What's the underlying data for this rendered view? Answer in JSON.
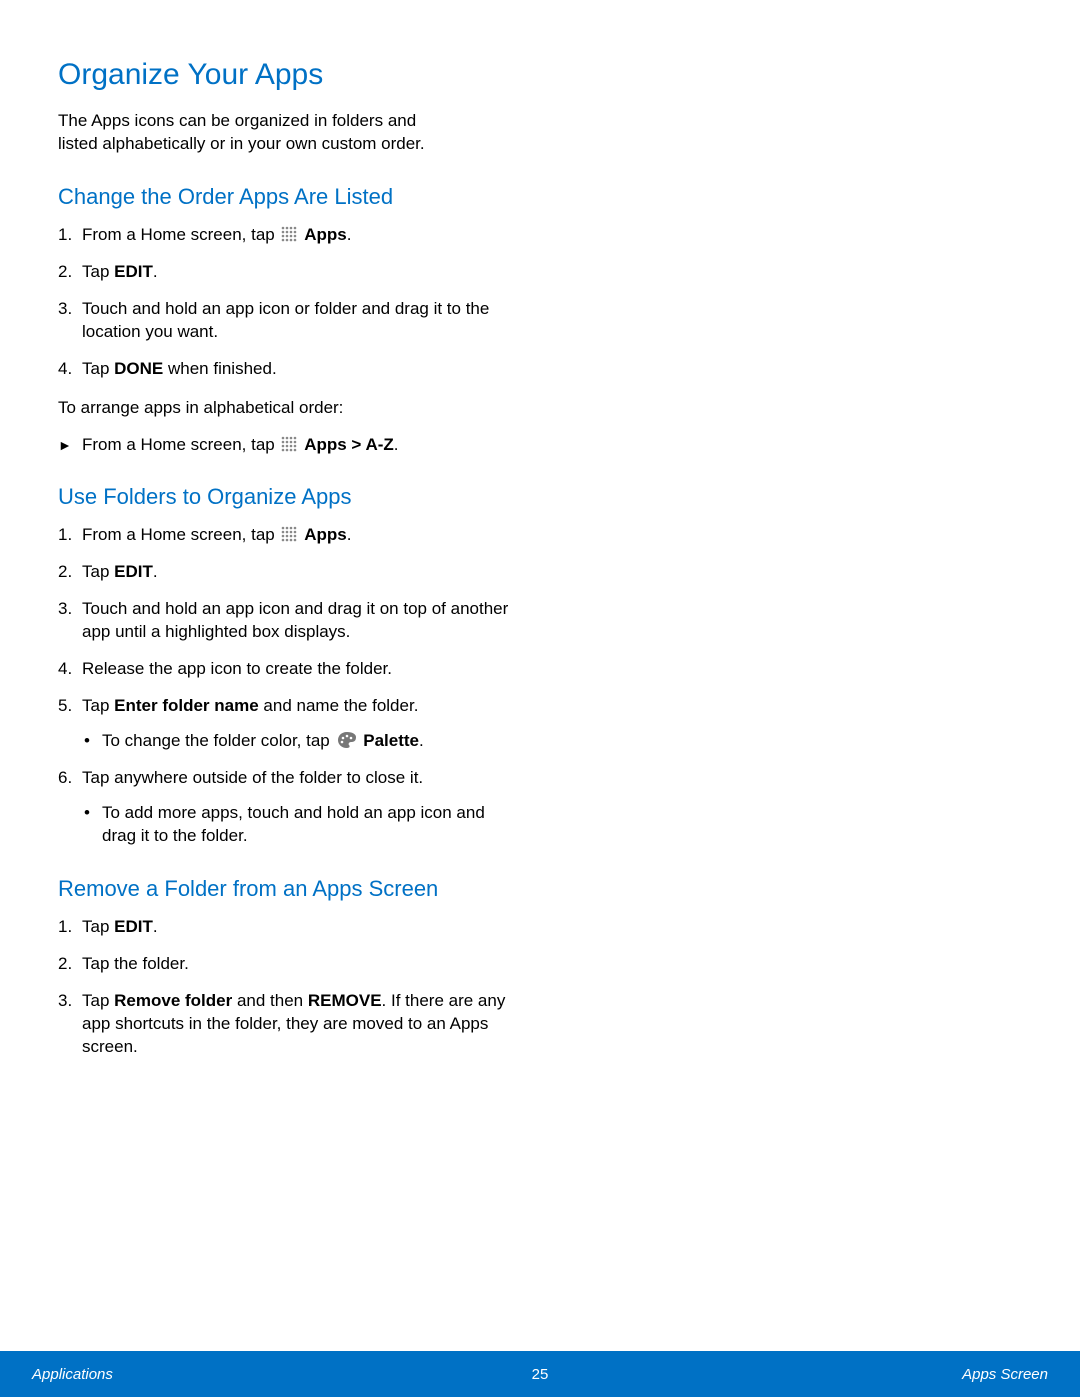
{
  "title": "Organize Your Apps",
  "intro_line1": "The Apps icons can be organized in folders and",
  "intro_line2": "listed alphabetically or in your own custom order.",
  "sections": {
    "s1": {
      "heading": "Change the Order Apps Are Listed",
      "step1_pre": "From a Home screen, tap ",
      "step1_bold": "Apps",
      "step2_pre": "Tap ",
      "step2_bold": "EDIT",
      "step3": "Touch and hold an app icon or folder and drag it to the location you want.",
      "step4_pre": "Tap ",
      "step4_bold": "DONE",
      "step4_post": " when finished.",
      "between": "To arrange apps in alphabetical order:",
      "arrow_pre": "From a Home screen, tap ",
      "arrow_bold": "Apps > A-Z"
    },
    "s2": {
      "heading": "Use Folders to Organize Apps",
      "step1_pre": "From a Home screen, tap ",
      "step1_bold": "Apps",
      "step2_pre": "Tap ",
      "step2_bold": "EDIT",
      "step3": "Touch and hold an app icon and drag it on top of another app until a highlighted box displays.",
      "step4": "Release the app icon to create the folder.",
      "step5_pre": "Tap ",
      "step5_bold": "Enter folder name",
      "step5_post": " and name the folder.",
      "step5_sub_pre": "To change the folder color, tap ",
      "step5_sub_bold": "Palette",
      "step6": "Tap anywhere outside of the folder to close it.",
      "step6_sub": "To add more apps, touch and hold an app icon and drag it to the folder."
    },
    "s3": {
      "heading": "Remove a Folder from an Apps Screen",
      "step1_pre": "Tap ",
      "step1_bold": "EDIT",
      "step2": "Tap the folder.",
      "step3_pre": "Tap ",
      "step3_bold1": "Remove folder",
      "step3_mid": " and then ",
      "step3_bold2": "REMOVE",
      "step3_post": ". If there are any app shortcuts in the folder, they are moved to an Apps screen."
    }
  },
  "footer": {
    "left": "Applications",
    "center": "25",
    "right": "Apps Screen"
  }
}
